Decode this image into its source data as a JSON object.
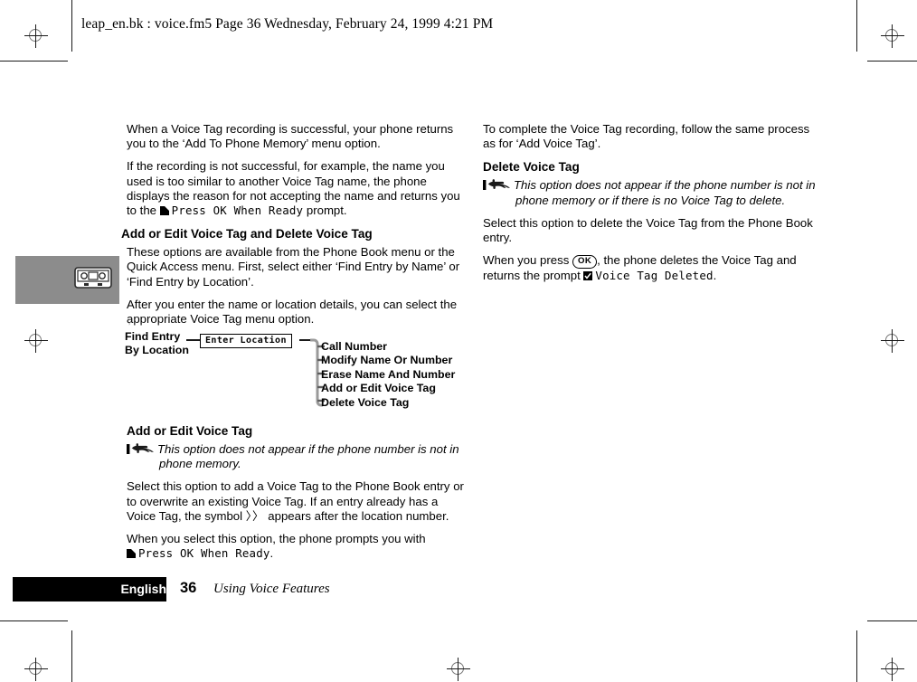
{
  "page_header": "leap_en.bk : voice.fm5  Page 36  Wednesday, February 24, 1999  4:21 PM",
  "chapter_tab": {
    "icon": "cassette-tape-icon",
    "background_color": "#8c8c8c"
  },
  "left_column": {
    "paragraph_1": "When a Voice Tag recording is successful, your phone returns you to the ‘Add To Phone Memory’ menu option.",
    "paragraph_2_part1": "If the recording is not successful, for example, the name you used is too similar to another Voice Tag name, the phone displays the reason for not accepting the name and returns you to the ",
    "paragraph_2_lcd": "Press OK When Ready",
    "paragraph_2_part2": " prompt.",
    "heading_1": "Add or Edit Voice Tag and Delete Voice Tag",
    "paragraph_3": "These options are available from the Phone Book menu or the Quick Access menu. First, select either ‘Find Entry by Name’ or ‘Find Entry by Location’.",
    "paragraph_4": "After you enter the name or location details, you can select the appropriate Voice Tag menu option.",
    "heading_2": "Add or Edit Voice Tag",
    "note_1": "This option does not appear if the phone number is not in phone memory.",
    "paragraph_5_part1": "Select this option to add a Voice Tag to the Phone Book entry or to overwrite an existing Voice Tag. If an entry already has a Voice Tag, the symbol ",
    "paragraph_5_symbol": "〉〉",
    "paragraph_5_part2": " appears after the location number.",
    "paragraph_6_part1": "When you select this option, the phone prompts you with ",
    "paragraph_6_lcd": "Press OK When Ready",
    "paragraph_6_part2": "."
  },
  "menu_diagram": {
    "source_label_line1": "Find Entry",
    "source_label_line2": "By Location",
    "lcd_box": "Enter Location",
    "items": [
      "Call Number",
      "Modify Name Or Number",
      "Erase Name And Number",
      "Add or Edit Voice Tag",
      "Delete Voice Tag"
    ]
  },
  "right_column": {
    "paragraph_1": "To complete the Voice Tag recording, follow the same process as for ‘Add Voice Tag’.",
    "heading_1": "Delete Voice Tag",
    "note_1": "This option does not appear if the phone number is not in phone memory or if there is no Voice Tag to delete.",
    "paragraph_2": "Select this option to delete the Voice Tag from the Phone Book entry.",
    "paragraph_3_part1": "When you press ",
    "paragraph_3_key": "OK",
    "paragraph_3_part2": ", the phone deletes the Voice Tag and returns the prompt ",
    "paragraph_3_lcd": "Voice Tag Deleted",
    "paragraph_3_part3": "."
  },
  "footer": {
    "language": "English",
    "page_number": "36",
    "section_title": "Using Voice Features"
  }
}
